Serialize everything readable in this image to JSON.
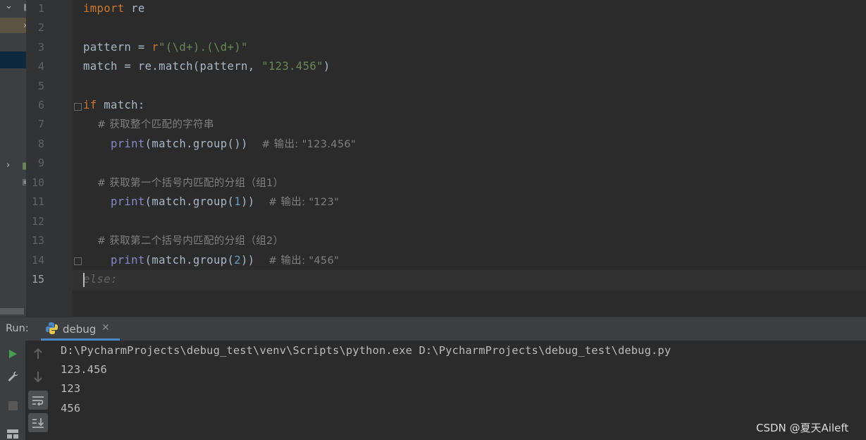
{
  "editor": {
    "lines": [
      {
        "n": "1"
      },
      {
        "n": "2"
      },
      {
        "n": "3"
      },
      {
        "n": "4"
      },
      {
        "n": "5"
      },
      {
        "n": "6"
      },
      {
        "n": "7"
      },
      {
        "n": "8"
      },
      {
        "n": "9"
      },
      {
        "n": "10"
      },
      {
        "n": "11"
      },
      {
        "n": "12"
      },
      {
        "n": "13"
      },
      {
        "n": "14"
      },
      {
        "n": "15"
      }
    ],
    "code": {
      "l1_kw": "import",
      "l1_rest": " re",
      "l3_a": "pattern = ",
      "l3_prefix": "r",
      "l3_str": "\"(\\d+).(\\d+)\"",
      "l4_a": "match = re.match(pattern, ",
      "l4_str": "\"123.456\"",
      "l4_b": ")",
      "l6_kw": "if",
      "l6_rest": " match:",
      "l7_cmt": "    # 获取整个匹配的字符串",
      "l8_bi": "    print",
      "l8_rest": "(match.group())  ",
      "l8_cmt": "# 输出: \"123.456\"",
      "l10_cmt": "    # 获取第一个括号内匹配的分组（组1）",
      "l11_bi": "    print",
      "l11_a": "(match.group(",
      "l11_num": "1",
      "l11_b": "))  ",
      "l11_cmt": "# 输出: \"123\"",
      "l13_cmt": "    # 获取第二个括号内匹配的分组（组2）",
      "l14_bi": "    print",
      "l14_a": "(match.group(",
      "l14_num": "2",
      "l14_b": "))  ",
      "l14_cmt": "# 输出: \"456\"",
      "l15_ghost": "else:"
    }
  },
  "run_panel": {
    "label": "Run:",
    "tab_label": "debug",
    "output": [
      "D:\\PycharmProjects\\debug_test\\venv\\Scripts\\python.exe D:\\PycharmProjects\\debug_test\\debug.py",
      "123.456",
      "123",
      "456"
    ]
  },
  "watermark": "CSDN @夏天Aileft",
  "colors": {
    "editor_bg": "#2b2b2b",
    "keyword": "#cc7832",
    "string": "#6a8759",
    "comment": "#808080",
    "builtin": "#8888c6",
    "number": "#6897bb",
    "run_green": "#499c54",
    "tab_underline": "#4a88c7"
  },
  "icons": [
    "chevron-down-icon",
    "chevron-right-icon",
    "python-icon",
    "close-icon",
    "run-icon",
    "wrench-icon",
    "stop-icon",
    "up-arrow-icon",
    "down-arrow-icon",
    "soft-wrap-icon",
    "scroll-to-end-icon",
    "layout-icon"
  ]
}
